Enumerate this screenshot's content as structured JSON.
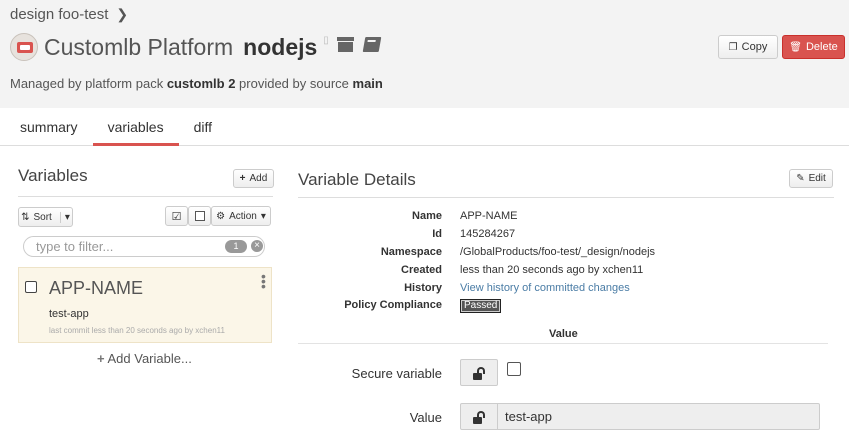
{
  "breadcrumb": {
    "text": "design foo-test",
    "chevron": "chevron-right-icon"
  },
  "header": {
    "product": "Customlb Platform",
    "name": "nodejs",
    "managed_prefix": "Managed by platform pack ",
    "pack": "customlb 2",
    "managed_mid": " provided by source ",
    "source": "main",
    "copy_label": "Copy",
    "delete_label": "Delete",
    "delete_color": "#d9534f"
  },
  "tabs": [
    {
      "label": "summary",
      "active": false
    },
    {
      "label": "variables",
      "active": true
    },
    {
      "label": "diff",
      "active": false
    }
  ],
  "variables_panel": {
    "title": "Variables",
    "add_label": "Add",
    "sort_label": "Sort",
    "action_label": "Action",
    "filter_placeholder": "type to filter...",
    "filter_count": "1",
    "items": [
      {
        "name": "APP-NAME",
        "value": "test-app",
        "commit": "last commit less than 20 seconds ago by xchen11"
      }
    ],
    "add_variable_label": "Add Variable..."
  },
  "details_panel": {
    "title": "Variable Details",
    "edit_label": "Edit",
    "rows": [
      {
        "label": "Name",
        "value": "APP-NAME"
      },
      {
        "label": "Id",
        "value": "145284267"
      },
      {
        "label": "Namespace",
        "value": "/GlobalProducts/foo-test/_design/nodejs"
      },
      {
        "label": "Created",
        "value": "less than 20 seconds ago by xchen11"
      },
      {
        "label": "History",
        "value": "View history of committed changes"
      },
      {
        "label": "Policy Compliance",
        "value": "Passed"
      }
    ],
    "value_header": "Value",
    "secure_label": "Secure variable",
    "value_label": "Value",
    "value_text": "test-app"
  }
}
